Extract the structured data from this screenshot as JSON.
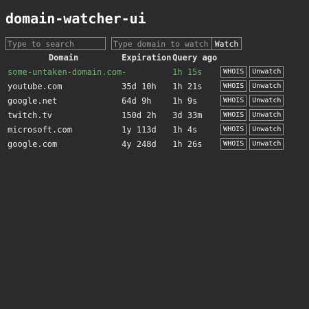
{
  "app": {
    "title": "domain-watcher-ui"
  },
  "controls": {
    "search_placeholder": "Type to search",
    "domain_placeholder": "Type domain to watch",
    "watch_label": "Watch"
  },
  "table": {
    "headers": {
      "domain": "Domain",
      "expiration": "Expiration",
      "query_ago": "Query ago"
    },
    "whois_label": "WHOIS",
    "unwatch_label": "Unwatch",
    "available_color": "#6ab36a",
    "rows": [
      {
        "domain": "some-untaken-domain.com",
        "expiration": "-",
        "query_ago": "1h 15s",
        "available": true
      },
      {
        "domain": "youtube.com",
        "expiration": "35d 10h",
        "query_ago": "1h 21s",
        "available": false
      },
      {
        "domain": "google.net",
        "expiration": "64d 9h",
        "query_ago": "1h 9s",
        "available": false
      },
      {
        "domain": "twitch.tv",
        "expiration": "150d 2h",
        "query_ago": "3d 33m",
        "available": false
      },
      {
        "domain": "microsoft.com",
        "expiration": "1y 113d",
        "query_ago": "1h 4s",
        "available": false
      },
      {
        "domain": "google.com",
        "expiration": "4y 248d",
        "query_ago": "1h 26s",
        "available": false
      }
    ]
  }
}
